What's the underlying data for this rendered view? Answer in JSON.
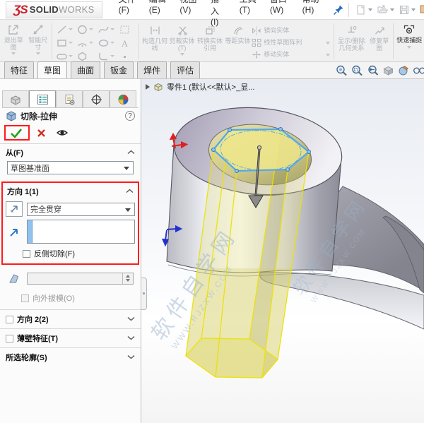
{
  "menubar": {
    "logo": {
      "mark": "ƷS",
      "bold": "SOLID",
      "light": "WORKS"
    },
    "menus": [
      "文件(F)",
      "编辑(E)",
      "视图(V)",
      "插入(I)",
      "工具(T)",
      "窗口(W)",
      "帮助(H)"
    ],
    "quick_access_icons": [
      "new-document",
      "open-document",
      "save"
    ]
  },
  "ribbon": {
    "exit_sketch": "退出草图",
    "smart_dimension": "智能尺寸",
    "sketch_tools": [
      {
        "icon": "line",
        "dropdown": true
      },
      {
        "icon": "circle",
        "dropdown": true
      },
      {
        "icon": "spline",
        "dropdown": true
      },
      {
        "icon": "plane",
        "dropdown": false
      },
      {
        "icon": "rect",
        "dropdown": true
      },
      {
        "icon": "arc",
        "dropdown": true
      },
      {
        "icon": "ellipse",
        "dropdown": true
      },
      {
        "icon": "textA",
        "dropdown": false
      },
      {
        "icon": "slot",
        "dropdown": true
      },
      {
        "icon": "polygon",
        "dropdown": false
      },
      {
        "icon": "fillet",
        "dropdown": true
      },
      {
        "icon": "point",
        "dropdown": false
      }
    ],
    "construction_geometry": "构造几何线",
    "trim_entities": "剪裁实体(T)",
    "convert_entities": "转换实体引用",
    "offset_entities": "等距实体",
    "mirror_entities": "镜向实体",
    "linear_pattern": "线性草图阵列",
    "move_entities": "移动实体",
    "display_delete_relations": "显示/删除几何关系",
    "repair_sketch": "修复草图",
    "quick_snaps": "快速捕捉"
  },
  "tabs": [
    {
      "label": "特征",
      "active": false
    },
    {
      "label": "草图",
      "active": true
    },
    {
      "label": "曲面",
      "active": false
    },
    {
      "label": "钣金",
      "active": false
    },
    {
      "label": "焊件",
      "active": false
    },
    {
      "label": "评估",
      "active": false
    }
  ],
  "property_manager": {
    "title": "切除-拉伸",
    "help": "?",
    "from_label": "从(F)",
    "from_value": "草图基准面",
    "direction1_label": "方向 1(1)",
    "end_condition": "完全贯穿",
    "flip_side_label": "反侧切除(F)",
    "draft_value": "",
    "draft_outward_label": "向外拔模(O)",
    "direction2_label": "方向 2(2)",
    "thin_feature_label": "薄壁特征(T)",
    "selected_contours_label": "所选轮廓(S)"
  },
  "viewport": {
    "tree_item": "零件1 (默认<<默认>_显...",
    "headsup_icons": [
      "zoom-fit",
      "zoom-area",
      "previous-view",
      "section-view",
      "view-settings",
      "hide-items"
    ],
    "watermark_line1": "软件自学网",
    "watermark_line2": "WWW.RJZXW.COM"
  },
  "colors": {
    "annotation_red": "#ff1a1a",
    "logo_red": "#c8202c",
    "check_green": "#22a022",
    "cancel_red": "#d03020",
    "sketch_blue": "#55a8e6",
    "preview_yellow": "#ece203",
    "selection_bar_blue": "#8fc3f2",
    "pin_blue": "#2a6fc0"
  }
}
